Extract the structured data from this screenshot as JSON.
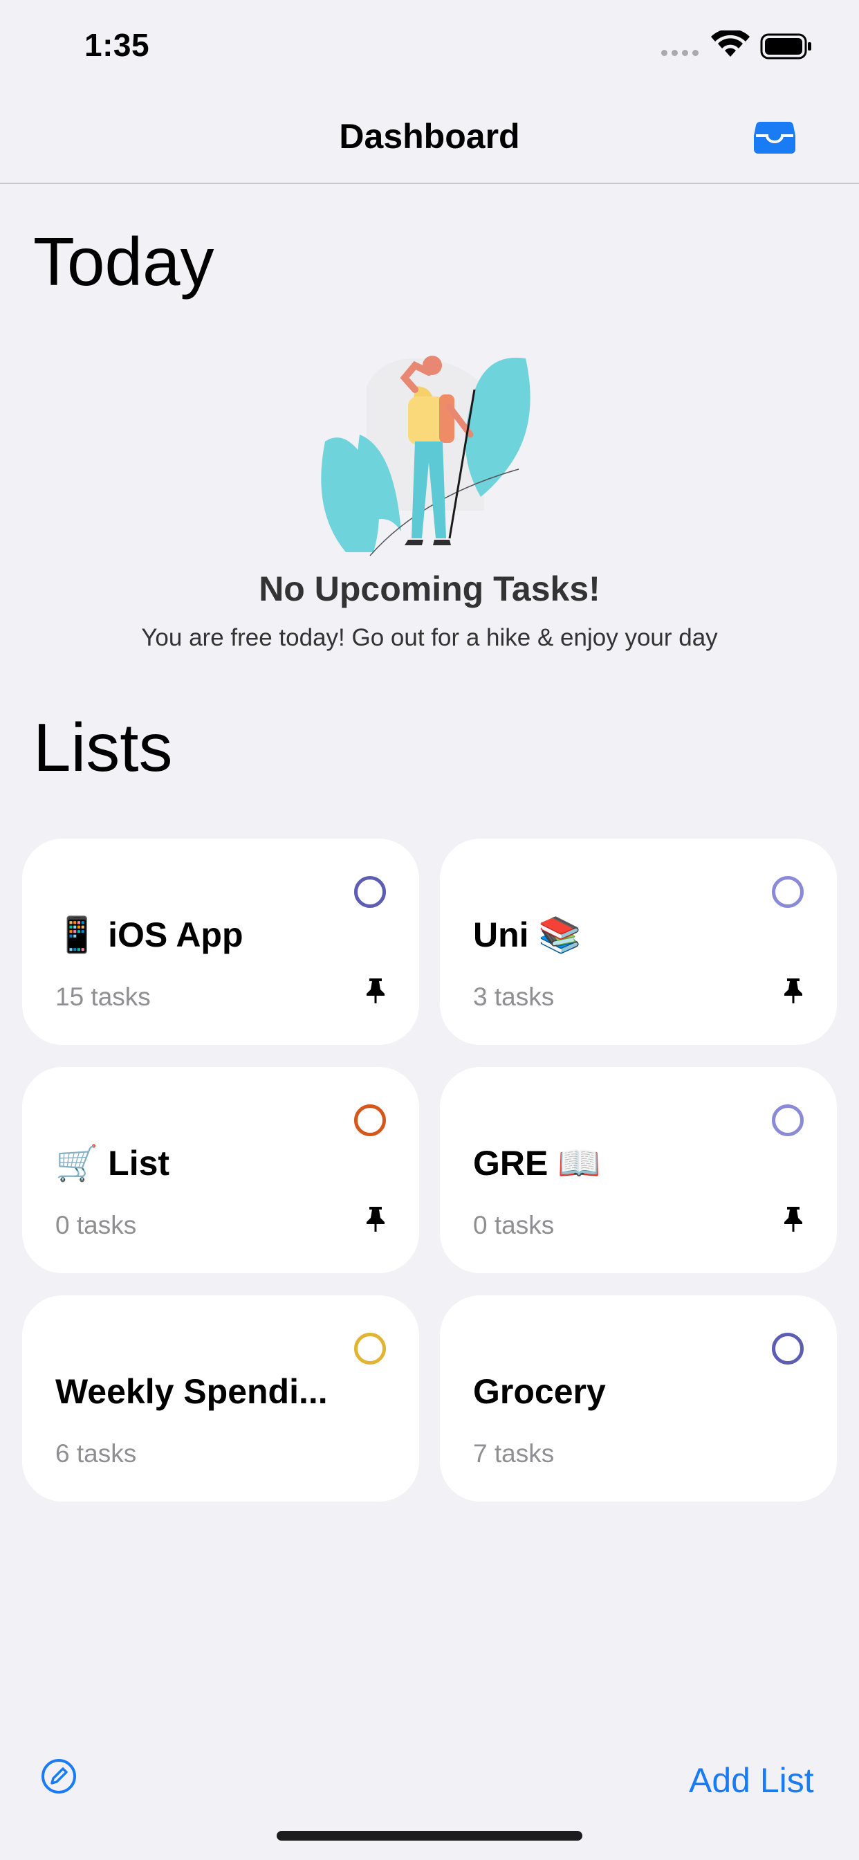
{
  "status_bar": {
    "time": "1:35"
  },
  "nav": {
    "title": "Dashboard",
    "right_icon": "tray-icon",
    "accent": "#1a7cf4"
  },
  "today": {
    "title": "Today",
    "empty_title": "No Upcoming Tasks!",
    "empty_subtitle": "You are free today! Go out for a hike & enjoy your day"
  },
  "lists": {
    "title": "Lists",
    "items": [
      {
        "name": "📱 iOS App",
        "count": "15 tasks",
        "ring_color": "#5d5db3",
        "pinned": true
      },
      {
        "name": "Uni 📚",
        "count": "3 tasks",
        "ring_color": "#8a8ad8",
        "pinned": true
      },
      {
        "name": "🛒 List",
        "count": "0 tasks",
        "ring_color": "#d4581c",
        "pinned": true
      },
      {
        "name": "GRE 📖",
        "count": "0 tasks",
        "ring_color": "#8a8ad8",
        "pinned": true
      },
      {
        "name": "Weekly Spendi...",
        "count": "6 tasks",
        "ring_color": "#e2b435",
        "pinned": false
      },
      {
        "name": "Grocery",
        "count": "7 tasks",
        "ring_color": "#5d5db3",
        "pinned": false
      }
    ]
  },
  "toolbar": {
    "add_list_label": "Add List",
    "left_icon": "compose-icon"
  }
}
